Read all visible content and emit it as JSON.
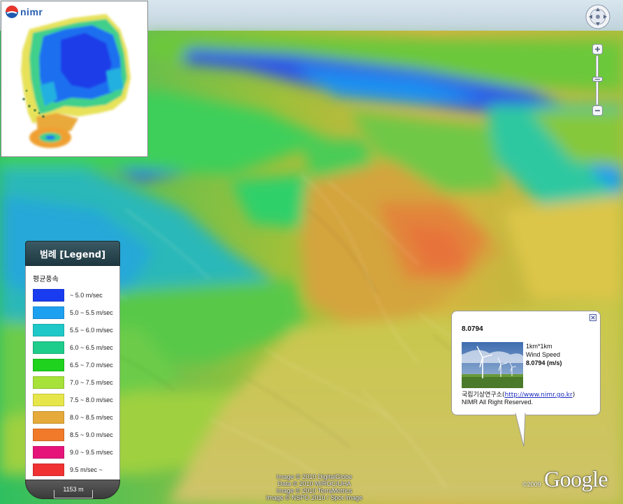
{
  "inset": {
    "logo_text": "nimr"
  },
  "legend": {
    "title": "범례 [Legend]",
    "subtitle": "평균풍속",
    "scale_label": "1153 m",
    "items": [
      {
        "label": "~ 5.0 m/sec",
        "color": "#1a3cf0"
      },
      {
        "label": "5.0 ~ 5.5 m/sec",
        "color": "#1ea0f0"
      },
      {
        "label": "5.5 ~ 6.0 m/sec",
        "color": "#1ec8c8"
      },
      {
        "label": "6.0 ~ 6.5 m/sec",
        "color": "#1ecc8c"
      },
      {
        "label": "6.5 ~ 7.0 m/sec",
        "color": "#1ed21e"
      },
      {
        "label": "7.0 ~ 7.5 m/sec",
        "color": "#a6e23a"
      },
      {
        "label": "7.5 ~ 8.0 m/sec",
        "color": "#e6e64a"
      },
      {
        "label": "8.0 ~ 8.5 m/sec",
        "color": "#e6aa3a"
      },
      {
        "label": "8.5 ~ 9.0 m/sec",
        "color": "#f07a2a"
      },
      {
        "label": "9.0 ~ 9.5 m/sec",
        "color": "#e6147a"
      },
      {
        "label": "9.5 m/sec ~",
        "color": "#f03232"
      }
    ]
  },
  "balloon": {
    "title": "8.0794",
    "info_line1": "1km*1km",
    "info_line2": "Wind Speed",
    "info_value": "8.0794 (m/s)",
    "org_prefix": "국립기상연구소(",
    "org_link": "http://www.nimr.go.kr",
    "org_suffix": ")",
    "rights": "NIMR All Right Reserved."
  },
  "attribution": {
    "line1": "Image © 2010 DigitalGlobe",
    "line2": "Data © 2010 MIROC/UHA",
    "line3": "Image © 2010 TerraMetrics",
    "line4": "Image © NSPO 2010 / Spot Image"
  },
  "copyright_year": "©2009",
  "google_logo": "Google"
}
